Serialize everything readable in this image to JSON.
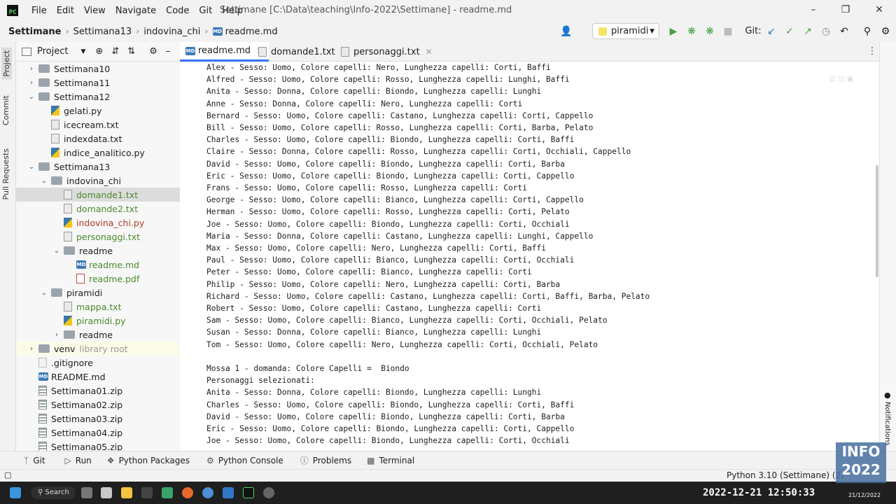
{
  "menu": [
    "File",
    "Edit",
    "View",
    "Navigate",
    "Code",
    "Git",
    "Help"
  ],
  "window_title": "Settimane [C:\\Data\\teaching\\Info-2022\\Settimane] - readme.md",
  "breadcrumb": [
    "Settimane",
    "Settimana13",
    "indovina_chi",
    "readme.md"
  ],
  "run_config": "piramidi",
  "git_label": "Git:",
  "project_header": "Project",
  "tree": [
    {
      "label": "Settimana10",
      "kind": "folder"
    },
    {
      "label": "Settimana11",
      "kind": "folder"
    },
    {
      "label": "Settimana12",
      "kind": "folder"
    },
    {
      "label": "gelati.py",
      "kind": "py"
    },
    {
      "label": "icecream.txt",
      "kind": "txt"
    },
    {
      "label": "indexdata.txt",
      "kind": "txt"
    },
    {
      "label": "indice_analitico.py",
      "kind": "py"
    },
    {
      "label": "Settimana13",
      "kind": "folder"
    },
    {
      "label": "indovina_chi",
      "kind": "folder"
    },
    {
      "label": "domande1.txt",
      "kind": "txt"
    },
    {
      "label": "domande2.txt",
      "kind": "txt"
    },
    {
      "label": "indovina_chi.py",
      "kind": "py"
    },
    {
      "label": "personaggi.txt",
      "kind": "txt"
    },
    {
      "label": "readme",
      "kind": "folder"
    },
    {
      "label": "readme.md",
      "kind": "md"
    },
    {
      "label": "readme.pdf",
      "kind": "pdf"
    },
    {
      "label": "piramidi",
      "kind": "folder"
    },
    {
      "label": "mappa.txt",
      "kind": "txt"
    },
    {
      "label": "piramidi.py",
      "kind": "py"
    },
    {
      "label": "readme",
      "kind": "folder"
    },
    {
      "label": "venv",
      "kind": "folder",
      "note": "library root"
    },
    {
      "label": ".gitignore",
      "kind": "git"
    },
    {
      "label": "README.md",
      "kind": "md"
    },
    {
      "label": "Settimana01.zip",
      "kind": "zip"
    },
    {
      "label": "Settimana02.zip",
      "kind": "zip"
    },
    {
      "label": "Settimana03.zip",
      "kind": "zip"
    },
    {
      "label": "Settimana04.zip",
      "kind": "zip"
    },
    {
      "label": "Settimana05.zip",
      "kind": "zip"
    }
  ],
  "tabs": [
    "readme.md",
    "domande1.txt",
    "personaggi.txt"
  ],
  "code_lines": [
    "Alex - Sesso: Uomo, Colore capelli: Nero, Lunghezza capelli: Corti, Baffi",
    "Alfred - Sesso: Uomo, Colore capelli: Rosso, Lunghezza capelli: Lunghi, Baffi",
    "Anita - Sesso: Donna, Colore capelli: Biondo, Lunghezza capelli: Lunghi",
    "Anne - Sesso: Donna, Colore capelli: Nero, Lunghezza capelli: Corti",
    "Bernard - Sesso: Uomo, Colore capelli: Castano, Lunghezza capelli: Corti, Cappello",
    "Bill - Sesso: Uomo, Colore capelli: Rosso, Lunghezza capelli: Corti, Barba, Pelato",
    "Charles - Sesso: Uomo, Colore capelli: Biondo, Lunghezza capelli: Corti, Baffi",
    "Claire - Sesso: Donna, Colore capelli: Rosso, Lunghezza capelli: Corti, Occhiali, Cappello",
    "David - Sesso: Uomo, Colore capelli: Biondo, Lunghezza capelli: Corti, Barba",
    "Eric - Sesso: Uomo, Colore capelli: Biondo, Lunghezza capelli: Corti, Cappello",
    "Frans - Sesso: Uomo, Colore capelli: Rosso, Lunghezza capelli: Corti",
    "George - Sesso: Uomo, Colore capelli: Bianco, Lunghezza capelli: Corti, Cappello",
    "Herman - Sesso: Uomo, Colore capelli: Rosso, Lunghezza capelli: Corti, Pelato",
    "Joe - Sesso: Uomo, Colore capelli: Biondo, Lunghezza capelli: Corti, Occhiali",
    "Maria - Sesso: Donna, Colore capelli: Castano, Lunghezza capelli: Lunghi, Cappello",
    "Max - Sesso: Uomo, Colore capelli: Nero, Lunghezza capelli: Corti, Baffi",
    "Paul - Sesso: Uomo, Colore capelli: Bianco, Lunghezza capelli: Corti, Occhiali",
    "Peter - Sesso: Uomo, Colore capelli: Bianco, Lunghezza capelli: Corti",
    "Philip - Sesso: Uomo, Colore capelli: Nero, Lunghezza capelli: Corti, Barba",
    "Richard - Sesso: Uomo, Colore capelli: Castano, Lunghezza capelli: Corti, Baffi, Barba, Pelato",
    "Robert - Sesso: Uomo, Colore capelli: Castano, Lunghezza capelli: Corti",
    "Sam - Sesso: Uomo, Colore capelli: Bianco, Lunghezza capelli: Corti, Occhiali, Pelato",
    "Susan - Sesso: Donna, Colore capelli: Bianco, Lunghezza capelli: Lunghi",
    "Tom - Sesso: Uomo, Colore capelli: Nero, Lunghezza capelli: Corti, Occhiali, Pelato",
    "",
    "Mossa 1 - domanda: Colore Capelli =  Biondo",
    "Personaggi selezionati:",
    "Anita - Sesso: Donna, Colore capelli: Biondo, Lunghezza capelli: Lunghi",
    "Charles - Sesso: Uomo, Colore capelli: Biondo, Lunghezza capelli: Corti, Baffi",
    "David - Sesso: Uomo, Colore capelli: Biondo, Lunghezza capelli: Corti, Barba",
    "Eric - Sesso: Uomo, Colore capelli: Biondo, Lunghezza capelli: Corti, Cappello",
    "Joe - Sesso: Uomo, Colore capelli: Biondo, Lunghezza capelli: Corti, Occhiali"
  ],
  "left_stripe": [
    "Project",
    "Commit",
    "Pull Requests"
  ],
  "right_stripe": [
    "Notifications"
  ],
  "tool_windows": [
    "Git",
    "Run",
    "Python Packages",
    "Python Console",
    "Problems",
    "Terminal"
  ],
  "status_interpreter": "Python 3.10 (Settimane) (2)",
  "badge": "INFO 2022",
  "taskbar": {
    "search": "Search",
    "clock": "2022-12-21 12:50:33",
    "date": "21/12/2022"
  },
  "colors": {
    "accent": "#3574f0",
    "run": "#43a047",
    "vcs": "#3c78aa"
  }
}
